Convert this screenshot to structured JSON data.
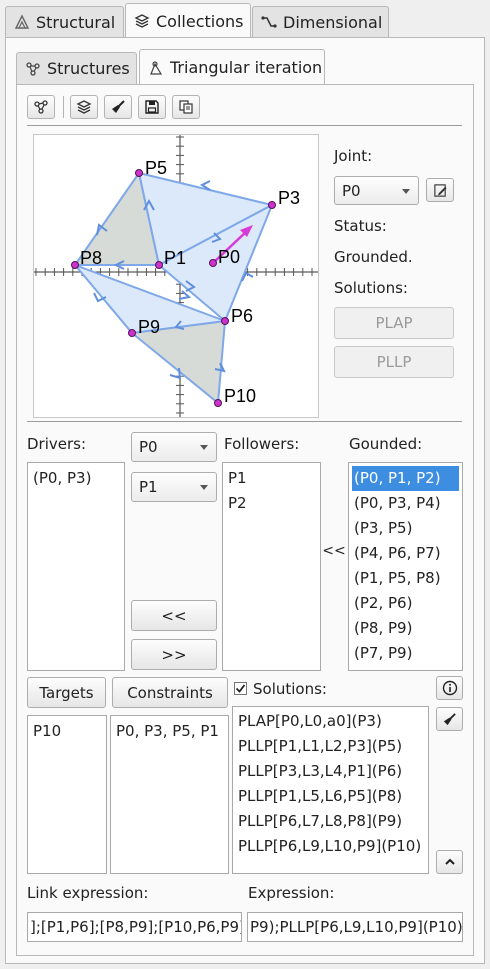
{
  "top_tabs": [
    {
      "label": "Structural",
      "icon": "structural-icon"
    },
    {
      "label": "Collections",
      "icon": "collections-icon"
    },
    {
      "label": "Dimensional",
      "icon": "dimensional-icon"
    }
  ],
  "sub_tabs": [
    {
      "label": "Structures",
      "icon": "structures-icon"
    },
    {
      "label": "Triangular iteration",
      "icon": "triangular-iteration-icon"
    }
  ],
  "toolbar": [
    {
      "name": "graph-icon"
    },
    {
      "name": "layers-icon"
    },
    {
      "name": "broom-icon"
    },
    {
      "name": "save-icon"
    },
    {
      "name": "copy-icon"
    }
  ],
  "joint": {
    "label": "Joint:",
    "value": "P0"
  },
  "status": {
    "label": "Status:",
    "value": "Grounded."
  },
  "solutions_side": {
    "label": "Solutions:",
    "plap": "PLAP",
    "pllp": "PLLP"
  },
  "drivers": {
    "label": "Drivers:",
    "items": [
      "(P0, P3)"
    ],
    "combo1": "P0",
    "combo2": "P1",
    "left_btn": "<<",
    "right_btn": ">>"
  },
  "followers": {
    "label": "Followers:",
    "items": [
      "P1",
      "P2"
    ],
    "arrow": "<<"
  },
  "grounded": {
    "label": "Gounded:",
    "items": [
      "(P0, P1, P2)",
      "(P0, P3, P4)",
      "(P3, P5)",
      "(P4, P6, P7)",
      "(P1, P5, P8)",
      "(P2, P6)",
      "(P8, P9)",
      "(P7, P9)"
    ],
    "selected": 0
  },
  "targets": {
    "button": "Targets",
    "items": [
      "P10"
    ]
  },
  "constraints": {
    "button": "Constraints",
    "items": [
      "P0, P3, P5, P1"
    ]
  },
  "solutions": {
    "label": "Solutions:",
    "checked": true,
    "items": [
      "PLAP[P0,L0,a0](P3)",
      "PLLP[P1,L1,L2,P3](P5)",
      "PLLP[P3,L3,L4,P1](P6)",
      "PLLP[P1,L5,L6,P5](P8)",
      "PLLP[P6,L7,L8,P8](P9)",
      "PLLP[P6,L9,L10,P9](P10)"
    ]
  },
  "link_expression": {
    "label": "Link expression:",
    "value": "];[P1,P6];[P8,P9];[P10,P6,P9]"
  },
  "expression": {
    "label": "Expression:",
    "value": "P9);PLLP[P6,L9,L10,P9](P10)"
  },
  "diagram_points": {
    "P0": "P0",
    "P1": "P1",
    "P3": "P3",
    "P5": "P5",
    "P6": "P6",
    "P8": "P8",
    "P9": "P9",
    "P10": "P10"
  },
  "colors": {
    "link": "#7fa8e8",
    "fill": "#dce9fa",
    "ground": "#d7dbd8",
    "driver": "#d83ad8",
    "joint": "#cc33cc"
  }
}
